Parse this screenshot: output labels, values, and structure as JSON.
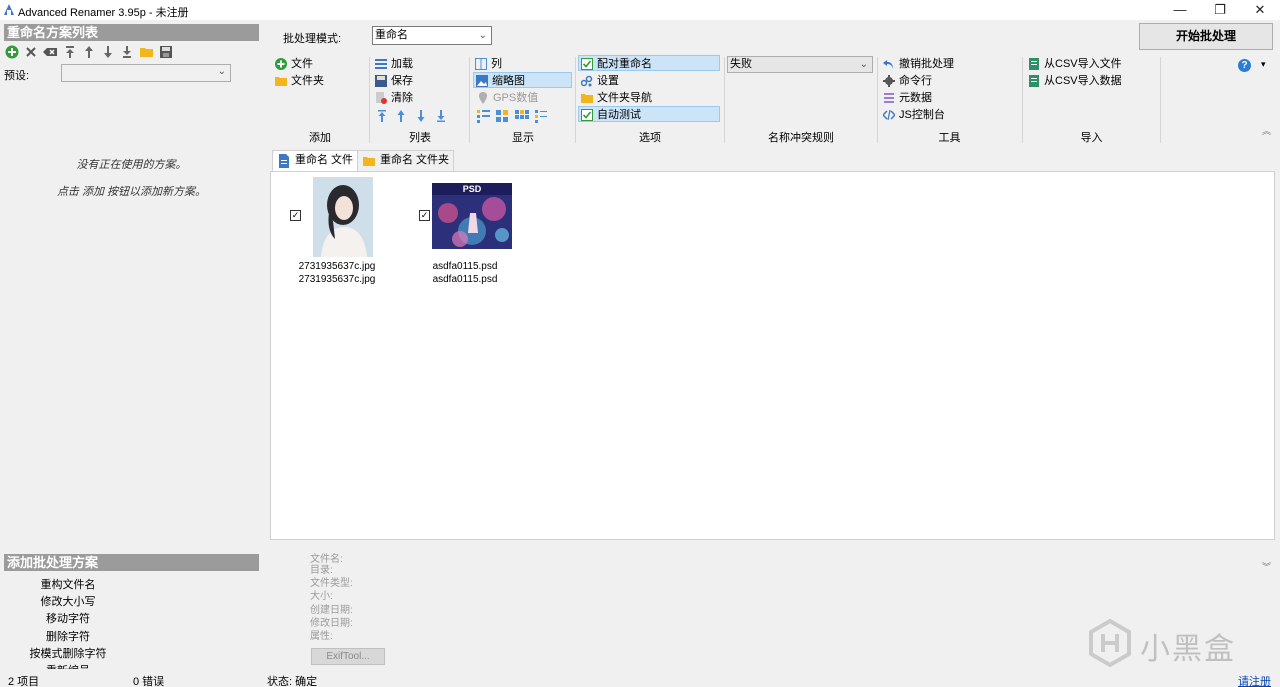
{
  "window": {
    "title": "Advanced Renamer 3.95p - 未注册",
    "minimize_glyph": "—",
    "restore_glyph": "❐",
    "close_glyph": "✕"
  },
  "left_panel": {
    "header": "重命名方案列表",
    "preset_label": "预设:",
    "preset_value": "",
    "empty_line1": "没有正在使用的方案。",
    "empty_line2": "点击 添加 按钮以添加新方案。",
    "methods_header": "添加批处理方案",
    "methods": [
      "重构文件名",
      "修改大小写",
      "移动字符",
      "删除字符",
      "按模式删除字符",
      "重新编号"
    ]
  },
  "ribbon": {
    "batch_mode_label": "批处理模式:",
    "batch_mode_value": "重命名",
    "start_button": "开始批处理",
    "add": {
      "file": "文件",
      "folder": "文件夹",
      "label": "添加"
    },
    "list": {
      "load": "加载",
      "save": "保存",
      "clear": "清除",
      "label": "列表"
    },
    "display": {
      "column": "列",
      "thumbnail": "缩略图",
      "gps": "GPS数值",
      "label": "显示"
    },
    "options": {
      "pair_rename": "配对重命名",
      "settings": "设置",
      "folder_nav": "文件夹导航",
      "auto_test": "自动测试",
      "label": "选项"
    },
    "conflict": {
      "value": "失败",
      "label": "名称冲突规则"
    },
    "tools": {
      "undo": "撤销批处理",
      "cmd": "命令行",
      "metadata": "元数据",
      "js_console": "JS控制台",
      "label": "工具"
    },
    "import": {
      "csv_files": "从CSV导入文件",
      "csv_data": "从CSV导入数据",
      "label": "导入"
    },
    "help_glyph": "?",
    "help_arrow": "▾",
    "collapse_glyph": "︽"
  },
  "tabs": [
    {
      "label": "重命名 文件",
      "active": true
    },
    {
      "label": "重命名 文件夹",
      "active": false
    }
  ],
  "files": [
    {
      "original": "2731935637c.jpg",
      "new": "2731935637c.jpg",
      "checked": true
    },
    {
      "original": "asdfa0115.psd",
      "new": "asdfa0115.psd",
      "checked": true,
      "thumb_text": "PSD"
    }
  ],
  "info_panel": {
    "labels": [
      "文件名:",
      "目录:",
      "文件类型:",
      "大小:",
      "创建日期:",
      "修改日期:",
      "属性:"
    ],
    "exif_button": "ExifTool...",
    "collapse_glyph": "︾"
  },
  "status": {
    "items": "2 项目",
    "errors": "0 错误",
    "state": "状态: 确定",
    "register": "请注册"
  },
  "watermark": "小黑盒",
  "colors": {
    "accent_blue": "#2b7cd3",
    "selection": "#cce4f7",
    "panel_header": "#9b9b9b",
    "add_green": "#2e9d3a",
    "folder_yellow": "#f2b51c"
  }
}
